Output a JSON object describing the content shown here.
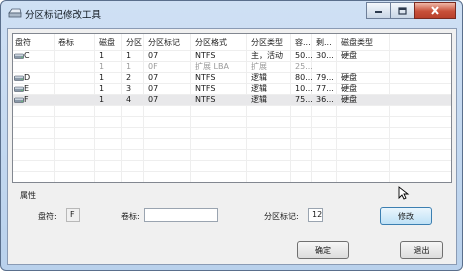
{
  "window": {
    "title": "分区标记修改工具"
  },
  "table": {
    "columns": [
      "盘符",
      "卷标",
      "磁盘",
      "分区",
      "分区标记",
      "分区格式",
      "分区类型",
      "容...",
      "剩...",
      "磁盘类型"
    ],
    "rows": [
      {
        "drive": "C",
        "volume": "",
        "disk": "1",
        "part": "1",
        "mark": "07",
        "format": "NTFS",
        "type": "主，活动",
        "cap": "50...",
        "free": "30...",
        "dtype": "硬盘",
        "dim": false,
        "selected": false,
        "icon": true
      },
      {
        "drive": "",
        "volume": "",
        "disk": "1",
        "part": "1",
        "mark": "0F",
        "format": "扩展 LBA",
        "type": "扩展",
        "cap": "25...",
        "free": "",
        "dtype": "",
        "dim": true,
        "selected": false,
        "icon": false
      },
      {
        "drive": "D",
        "volume": "",
        "disk": "1",
        "part": "2",
        "mark": "07",
        "format": "NTFS",
        "type": "逻辑",
        "cap": "80...",
        "free": "79...",
        "dtype": "硬盘",
        "dim": false,
        "selected": false,
        "icon": true
      },
      {
        "drive": "E",
        "volume": "",
        "disk": "1",
        "part": "3",
        "mark": "07",
        "format": "NTFS",
        "type": "逻辑",
        "cap": "10...",
        "free": "77...",
        "dtype": "硬盘",
        "dim": false,
        "selected": false,
        "icon": true
      },
      {
        "drive": "F",
        "volume": "",
        "disk": "1",
        "part": "4",
        "mark": "07",
        "format": "NTFS",
        "type": "逻辑",
        "cap": "75...",
        "free": "36...",
        "dtype": "硬盘",
        "dim": false,
        "selected": true,
        "icon": true
      }
    ]
  },
  "properties": {
    "title": "属性",
    "drive_label": "盘符:",
    "drive_value": "F",
    "volume_label": "卷标:",
    "volume_value": "",
    "mark_label": "分区标记:",
    "mark_value": "12"
  },
  "buttons": {
    "modify": "修改",
    "ok": "确定",
    "exit": "退出"
  },
  "colors": {
    "close_red": "#c8503a",
    "selection_gray": "#e8e8ea",
    "title_blue": "#cfe0f4"
  }
}
